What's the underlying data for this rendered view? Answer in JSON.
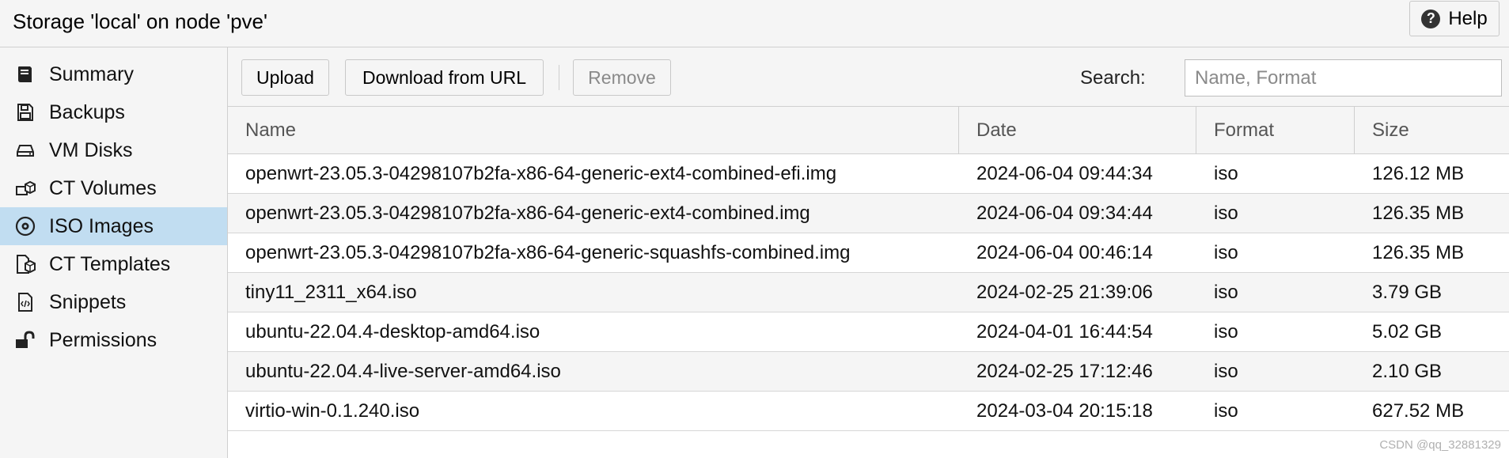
{
  "header": {
    "title": "Storage 'local' on node 'pve'",
    "help_label": "Help"
  },
  "sidebar": {
    "items": [
      {
        "label": "Summary",
        "icon": "book-icon",
        "active": false
      },
      {
        "label": "Backups",
        "icon": "floppy-disk-icon",
        "active": false
      },
      {
        "label": "VM Disks",
        "icon": "hard-drive-icon",
        "active": false
      },
      {
        "label": "CT Volumes",
        "icon": "container-disk-icon",
        "active": false
      },
      {
        "label": "ISO Images",
        "icon": "optical-disc-icon",
        "active": true
      },
      {
        "label": "CT Templates",
        "icon": "template-file-icon",
        "active": false
      },
      {
        "label": "Snippets",
        "icon": "code-file-icon",
        "active": false
      },
      {
        "label": "Permissions",
        "icon": "unlock-icon",
        "active": false
      }
    ]
  },
  "toolbar": {
    "upload_label": "Upload",
    "download_label": "Download from URL",
    "remove_label": "Remove",
    "search_label": "Search:",
    "search_placeholder": "Name, Format",
    "search_value": ""
  },
  "table": {
    "columns": [
      "Name",
      "Date",
      "Format",
      "Size"
    ],
    "rows": [
      [
        "openwrt-23.05.3-04298107b2fa-x86-64-generic-ext4-combined-efi.img",
        "2024-06-04 09:44:34",
        "iso",
        "126.12 MB"
      ],
      [
        "openwrt-23.05.3-04298107b2fa-x86-64-generic-ext4-combined.img",
        "2024-06-04 09:34:44",
        "iso",
        "126.35 MB"
      ],
      [
        "openwrt-23.05.3-04298107b2fa-x86-64-generic-squashfs-combined.img",
        "2024-06-04 00:46:14",
        "iso",
        "126.35 MB"
      ],
      [
        "tiny11_2311_x64.iso",
        "2024-02-25 21:39:06",
        "iso",
        "3.79 GB"
      ],
      [
        "ubuntu-22.04.4-desktop-amd64.iso",
        "2024-04-01 16:44:54",
        "iso",
        "5.02 GB"
      ],
      [
        "ubuntu-22.04.4-live-server-amd64.iso",
        "2024-02-25 17:12:46",
        "iso",
        "2.10 GB"
      ],
      [
        "virtio-win-0.1.240.iso",
        "2024-03-04 20:15:18",
        "iso",
        "627.52 MB"
      ]
    ]
  },
  "watermark": "CSDN @qq_32881329",
  "colors": {
    "active_nav": "#c1ddf1",
    "panel_bg": "#f5f5f5",
    "border": "#cfcfcf"
  }
}
